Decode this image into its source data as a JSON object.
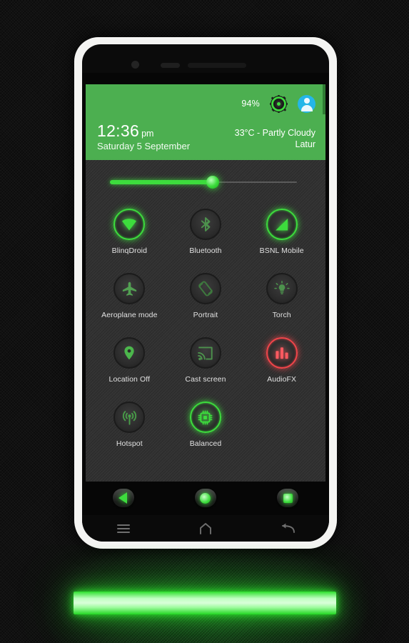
{
  "shade": {
    "header": {
      "battery_percent": "94%",
      "settings_icon": "gear-icon",
      "avatar_icon": "user-avatar-icon",
      "time": "12:36",
      "ampm": "pm",
      "date": "Saturday 5 September",
      "weather": "33°C - Partly Cloudy",
      "city": "Latur",
      "background_color": "#4caf50"
    },
    "brightness": {
      "label": "brightness-slider",
      "value_percent": 55,
      "fill_color": "#3ddc3d",
      "track_color": "#5b5b5b"
    },
    "tiles": [
      {
        "label": "BlinqDroid",
        "icon": "wifi-icon",
        "state": "on",
        "accent": "#3ddc3d"
      },
      {
        "label": "Bluetooth",
        "icon": "bluetooth-icon",
        "state": "off",
        "accent": "#4f8f4f"
      },
      {
        "label": "BSNL Mobile",
        "icon": "signal-icon",
        "state": "on",
        "accent": "#3ddc3d"
      },
      {
        "label": "Aeroplane mode",
        "icon": "airplane-icon",
        "state": "off",
        "accent": "#4f8f4f"
      },
      {
        "label": "Portrait",
        "icon": "rotation-icon",
        "state": "off",
        "accent": "#3f7a3f"
      },
      {
        "label": "Torch",
        "icon": "flashlight-icon",
        "state": "off",
        "accent": "#4f8f4f"
      },
      {
        "label": "Location Off",
        "icon": "location-icon",
        "state": "off",
        "accent": "#55c055"
      },
      {
        "label": "Cast screen",
        "icon": "cast-icon",
        "state": "off",
        "accent": "#4f9a4f"
      },
      {
        "label": "AudioFX",
        "icon": "equalizer-icon",
        "state": "on",
        "accent": "#f0454a"
      },
      {
        "label": "Hotspot",
        "icon": "hotspot-icon",
        "state": "off",
        "accent": "#3f7a3f"
      },
      {
        "label": "Balanced",
        "icon": "cpu-chip-icon",
        "state": "on",
        "accent": "#3ddc3d"
      }
    ]
  },
  "navbar": {
    "back": "back-button",
    "home": "home-button",
    "recents": "recents-button"
  },
  "capacitive_keys": {
    "menu": "menu-key",
    "home": "home-key",
    "back": "back-key"
  },
  "accent_colors": {
    "green": "#3ddc3d",
    "header_green": "#4caf50",
    "red": "#f0454a",
    "avatar_blue": "#24b6e8",
    "panel_dark": "#333333"
  }
}
